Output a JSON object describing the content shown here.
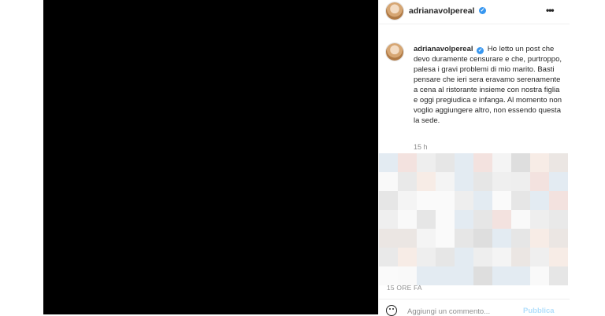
{
  "post": {
    "username": "adrianavolpereal",
    "header_menu_icon": "more-horizontal-icon",
    "verified_icon": "verified-badge-icon"
  },
  "caption": {
    "username": "adrianavolpereal",
    "text": "Ho letto un post che devo duramente censurare e che, purtroppo, palesa i gravi problemi di mio marito. Basti pensare che ieri sera eravamo serenamente a cena al ristorante insieme con nostra figlia e oggi pregiudica e infanga. Al momento non voglio aggiungere altro, non essendo questa la sede.",
    "time": "15 h"
  },
  "footer": {
    "time_ago": "15 ORE FA",
    "comment_placeholder": "Aggiungi un commento...",
    "publish_label": "Pubblica",
    "emoji_icon": "emoji-smiley-icon"
  },
  "colors": {
    "verified": "#3897f0",
    "muted": "#8e8e8e",
    "publish_disabled": "#b2dffc"
  }
}
